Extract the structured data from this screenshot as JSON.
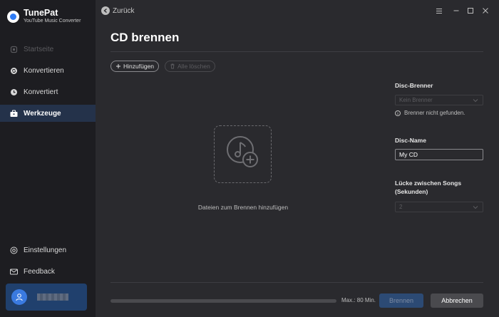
{
  "app": {
    "name": "TunePat",
    "subtitle": "YouTube Music Converter"
  },
  "sidebar": {
    "items": [
      {
        "label": "Startseite",
        "icon": "home-icon",
        "state": "disabled"
      },
      {
        "label": "Konvertieren",
        "icon": "convert-icon",
        "state": "normal"
      },
      {
        "label": "Konvertiert",
        "icon": "clock-icon",
        "state": "normal"
      },
      {
        "label": "Werkzeuge",
        "icon": "toolbox-icon",
        "state": "active"
      }
    ],
    "bottom_items": [
      {
        "label": "Einstellungen",
        "icon": "gear-icon"
      },
      {
        "label": "Feedback",
        "icon": "mail-icon"
      }
    ],
    "user_icon": "user-icon"
  },
  "header": {
    "back_label": "Zurück"
  },
  "page": {
    "title": "CD brennen",
    "add_label": "Hinzufügen",
    "clear_label": "Alle löschen",
    "drop_text": "Dateien zum Brennen hinzufügen"
  },
  "settings": {
    "burner_label": "Disc-Brenner",
    "burner_value": "Kein Brenner",
    "burner_note": "Brenner nicht gefunden.",
    "disc_name_label": "Disc-Name",
    "disc_name_value": "My CD",
    "gap_label_line1": "Lücke zwischen Songs",
    "gap_label_line2": "(Sekunden)",
    "gap_value": "2"
  },
  "footer": {
    "capacity_used_fraction": 0,
    "max_text": "Max.: 80 Min.",
    "burn_label": "Brennen",
    "cancel_label": "Abbrechen"
  },
  "colors": {
    "sidebar_bg": "#1d1d21",
    "main_bg": "#2a2a2e",
    "active_item_bg": "#24324a",
    "accent": "#2f7cf6"
  }
}
